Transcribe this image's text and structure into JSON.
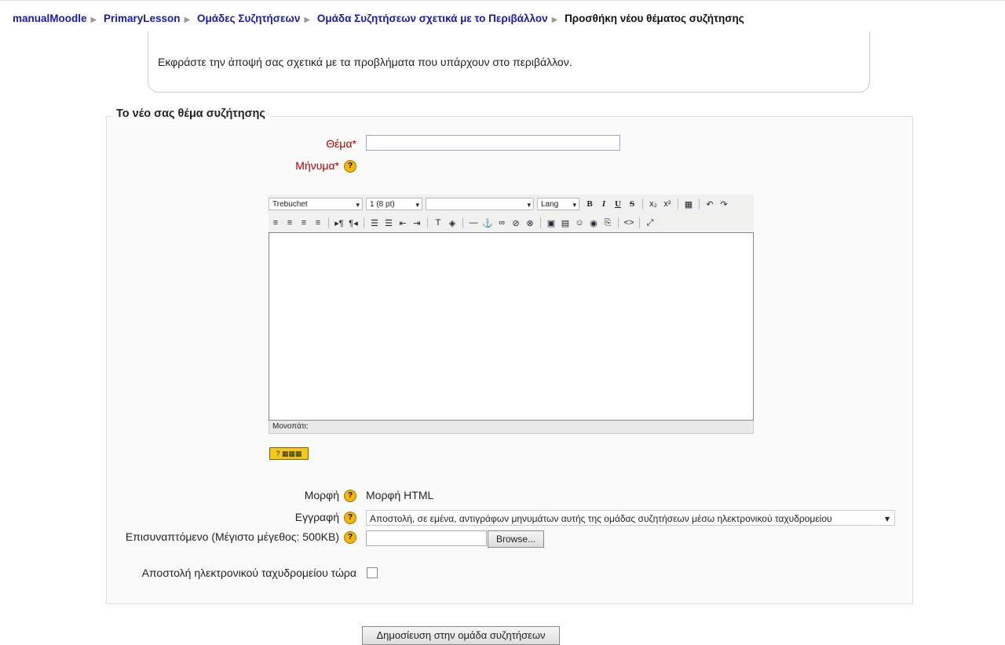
{
  "breadcrumb": {
    "items": [
      "manualMoodle",
      "PrimaryLesson",
      "Ομάδες Συζητήσεων",
      "Ομάδα Συζητήσεων σχετικά με το Περιβάλλον"
    ],
    "current": "Προσθήκη νέου θέματος συζήτησης"
  },
  "intro": "Εκφράστε την άποψή σας σχετικά με τα προβλήματα που υπάρχουν στο περιβάλλον.",
  "form": {
    "legend": "Το νέο σας θέμα συζήτησης",
    "subject_label": "Θέμα*",
    "message_label": "Μήνυμα*",
    "format_label": "Μορφή",
    "format_value": "Μορφή HTML",
    "subscription_label": "Εγγραφή",
    "subscription_value": "Αποστολή, σε εμένα, αντιγράφων μηνυμάτων αυτής της ομάδας συζητήσεων μέσω ηλεκτρονικού ταχυδρομείου",
    "attachment_label": "Επισυναπτόμενο (Μέγιστο μέγεθος: 500KB)",
    "browse_label": "Browse...",
    "mailnow_label": "Αποστολή ηλεκτρονικού ταχυδρομείου τώρα",
    "submit_label": "Δημοσίευση στην ομάδα συζητήσεων"
  },
  "editor": {
    "font": "Trebuchet",
    "size": "1 (8 pt)",
    "lang": "Lang",
    "status_path": "Μονοπάτι:"
  }
}
